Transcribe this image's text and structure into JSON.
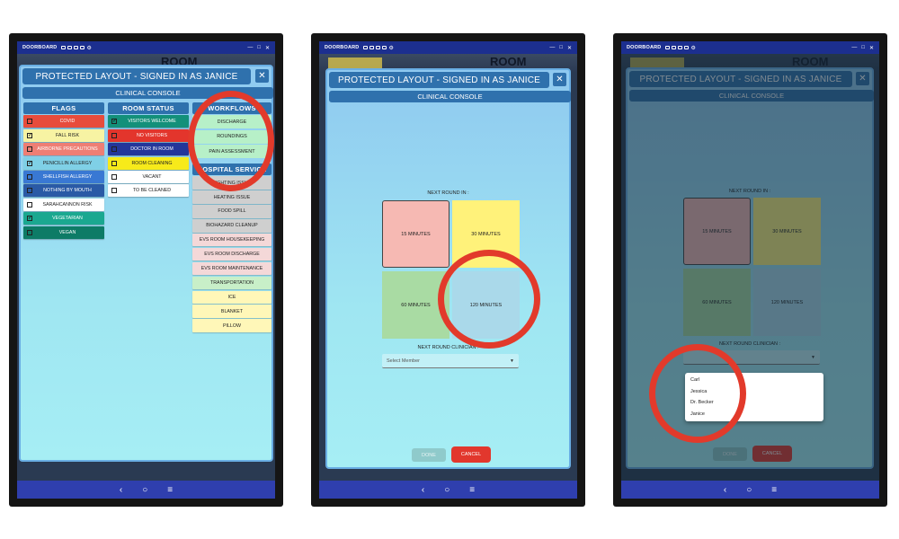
{
  "app": {
    "name": "DOORBOARD",
    "dialog_title": "PROTECTED LAYOUT - SIGNED IN AS JANICE",
    "close_label": "✕",
    "console_label": "CLINICAL CONSOLE",
    "background_room_text": "ROOM",
    "nav": {
      "back": "‹",
      "home": "○",
      "recents": "≡"
    },
    "window_controls": {
      "minimize": "—",
      "maximize": "□",
      "close": "✕"
    }
  },
  "screen1": {
    "flags": {
      "title": "FLAGS",
      "items": [
        {
          "label": "COVID",
          "checked": false,
          "color": "#e74c3c",
          "text_color": "#ffffff"
        },
        {
          "label": "FALL RISK",
          "checked": true,
          "color": "#f7f3a3",
          "text_color": "#222222"
        },
        {
          "label": "AIRBORNE PRECAUTIONS",
          "checked": false,
          "color": "#ee7e74",
          "text_color": "#ffffff"
        },
        {
          "label": "PENICILLIN ALLERGY",
          "checked": true,
          "color": "#7fd0e6",
          "text_color": "#222222"
        },
        {
          "label": "SHELLFISH ALLERGY",
          "checked": false,
          "color": "#3978d3",
          "text_color": "#ffffff"
        },
        {
          "label": "NOTHING BY MOUTH",
          "checked": false,
          "color": "#2a5aa6",
          "text_color": "#ffffff"
        },
        {
          "label": "SARAHCANNON RISK",
          "checked": false,
          "color": "#ffffff",
          "text_color": "#222222"
        },
        {
          "label": "VEGETARIAN",
          "checked": true,
          "color": "#1aa890",
          "text_color": "#ffffff"
        },
        {
          "label": "VEGAN",
          "checked": false,
          "color": "#0d7b66",
          "text_color": "#ffffff"
        }
      ]
    },
    "room_status": {
      "title": "ROOM STATUS",
      "items": [
        {
          "label": "VISITORS WELCOME",
          "checked": true,
          "color": "#13907a",
          "text_color": "#ffffff"
        },
        {
          "label": "NO VISITORS",
          "checked": false,
          "color": "#e3352c",
          "text_color": "#ffffff"
        },
        {
          "label": "DOCTOR IN ROOM",
          "checked": false,
          "color": "#24369a",
          "text_color": "#ffffff"
        },
        {
          "label": "ROOM CLEANING",
          "checked": false,
          "color": "#f7ea1a",
          "text_color": "#222222"
        },
        {
          "label": "VACANT",
          "checked": false,
          "color": "#ffffff",
          "text_color": "#222222"
        },
        {
          "label": "TO BE CLEANED",
          "checked": false,
          "color": "#ffffff",
          "text_color": "#222222"
        }
      ]
    },
    "workflows": {
      "title": "WORKFLOWS",
      "items": [
        {
          "label": "DISCHARGE",
          "color": "#b7f0c8"
        },
        {
          "label": "ROUNDINGS",
          "color": "#b7f0c8"
        },
        {
          "label": "PAIN ASSESSMENT",
          "color": "#b7f0c8"
        }
      ]
    },
    "hospital_services": {
      "title": "HOSPITAL SERVICE",
      "items": [
        {
          "label": "LIGHTING ISSUE",
          "color": "#cfcfcf"
        },
        {
          "label": "HEATING ISSUE",
          "color": "#cfcfcf"
        },
        {
          "label": "FOOD SPILL",
          "color": "#cfcfcf"
        },
        {
          "label": "BIOHAZARD CLEANUP",
          "color": "#cfcfcf"
        },
        {
          "label": "EVS ROOM HOUSEKEEPING",
          "color": "#f4d8d8"
        },
        {
          "label": "EVS ROOM DISCHARGE",
          "color": "#f4d8d8"
        },
        {
          "label": "EVS ROOM MAINTENANCE",
          "color": "#f4d8d8"
        },
        {
          "label": "TRANSPORTATION",
          "color": "#c8efc8"
        },
        {
          "label": "ICE",
          "color": "#fff7b8"
        },
        {
          "label": "BLANKET",
          "color": "#fff7b8"
        },
        {
          "label": "PILLOW",
          "color": "#fff7b8"
        }
      ]
    }
  },
  "screen2": {
    "next_round_label": "NEXT ROUND IN :",
    "tiles": [
      {
        "label": "15 MINUTES",
        "color": "#f6b9b3",
        "selected": true
      },
      {
        "label": "30 MINUTES",
        "color": "#fff27a",
        "selected": false
      },
      {
        "label": "60 MINUTES",
        "color": "#a9dba3",
        "selected": false
      },
      {
        "label": "120 MINUTES",
        "color": "#aad9ea",
        "selected": false
      }
    ],
    "clinician_label": "NEXT ROUND CLINICIAN :",
    "select_placeholder": "Select Member",
    "done_label": "DONE",
    "cancel_label": "CANCEL"
  },
  "screen3": {
    "members": [
      "Carl",
      "Jessica",
      "Dr. Becker",
      "Janice"
    ]
  },
  "colors": {
    "accent_blue": "#2f71ad",
    "status_bar": "#1c2f8f",
    "highlight_ring": "#e23a2b"
  }
}
